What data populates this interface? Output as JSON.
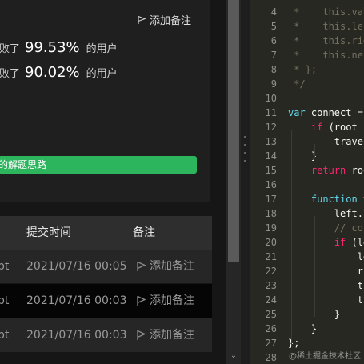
{
  "result": {
    "add_note": "添加备注",
    "stats": [
      {
        "prefix": "击败了",
        "percent": "99.53%",
        "suffix": "的用户"
      },
      {
        "prefix": "击败了",
        "percent": "90.02%",
        "suffix": "的用户"
      }
    ],
    "solution_button": "我的解题思路"
  },
  "table": {
    "headers": [
      "提交时间",
      "备注"
    ],
    "rows": [
      {
        "lang": "pt",
        "time": "2021/07/16 00:05",
        "note": "添加备注"
      },
      {
        "lang": "pt",
        "time": "2021/07/16 00:03",
        "note": "添加备注"
      },
      {
        "lang": "pt",
        "time": "2021/07/16 00:03",
        "note": "添加备注"
      }
    ]
  },
  "editor": {
    "lines": [
      {
        "n": "4",
        "text": " *    this.val"
      },
      {
        "n": "5",
        "text": " *    this.left"
      },
      {
        "n": "6",
        "text": " *    this.rig"
      },
      {
        "n": "7",
        "text": " *    this.nex"
      },
      {
        "n": "8",
        "text": " * };"
      },
      {
        "n": "9",
        "text": " */"
      },
      {
        "n": "10",
        "text": ""
      },
      {
        "n": "11",
        "text": "var connect ="
      },
      {
        "n": "12",
        "text": "    if (root !"
      },
      {
        "n": "13",
        "text": "        trave("
      },
      {
        "n": "14",
        "text": "    }"
      },
      {
        "n": "15",
        "text": "    return roo"
      },
      {
        "n": "16",
        "text": ""
      },
      {
        "n": "17",
        "text": "    function t"
      },
      {
        "n": "18",
        "text": "        left.n"
      },
      {
        "n": "19",
        "text": "        // co"
      },
      {
        "n": "20",
        "text": "        if (le"
      },
      {
        "n": "21",
        "text": "            le"
      },
      {
        "n": "22",
        "text": "            ri"
      },
      {
        "n": "23",
        "text": "            tr"
      },
      {
        "n": "24",
        "text": "            tr"
      },
      {
        "n": "25",
        "text": "        }"
      },
      {
        "n": "26",
        "text": "    }"
      },
      {
        "n": "27",
        "text": "};"
      },
      {
        "n": "28",
        "text": ""
      }
    ],
    "watermark": "@稀土掘金技术社区"
  },
  "colors": {
    "accent_green": "#2db55d",
    "editor_bg": "#272822",
    "comment": "#75715e",
    "keyword": "#66d9ef",
    "function": "#a6e22e"
  }
}
